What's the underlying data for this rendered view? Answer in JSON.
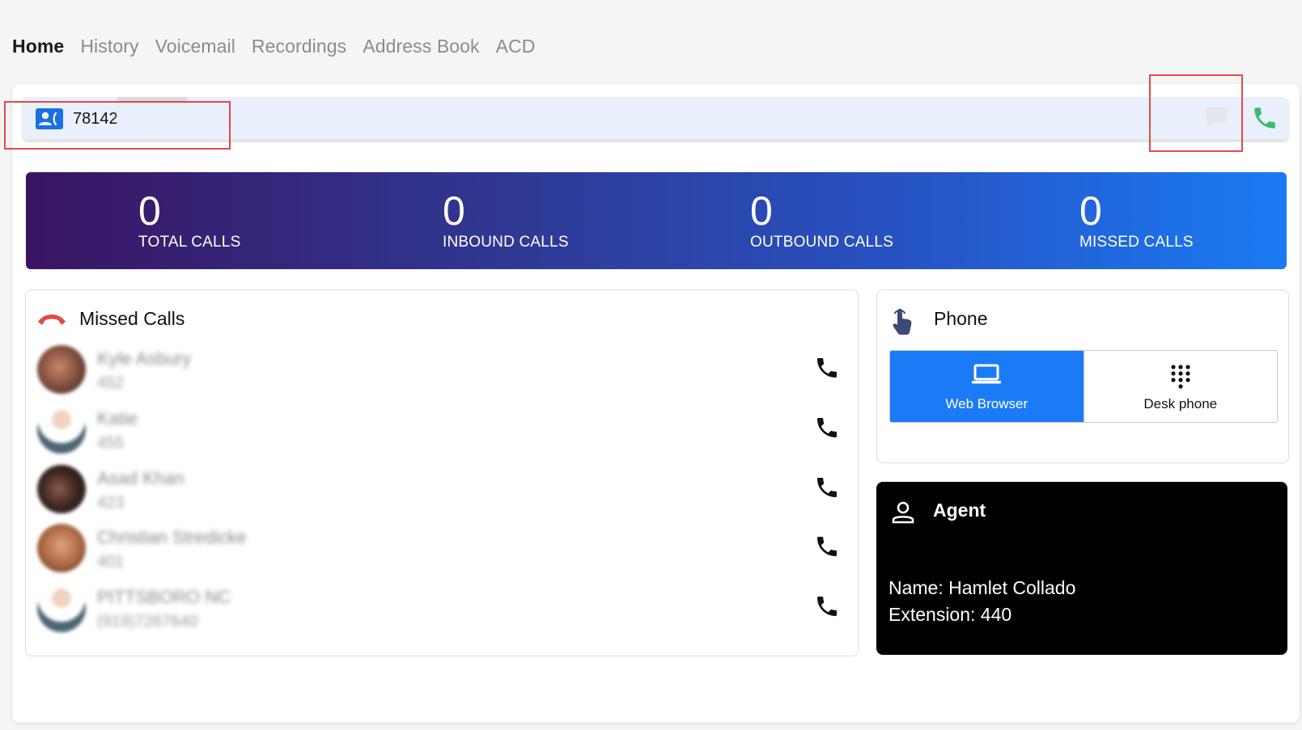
{
  "nav": {
    "tabs": [
      {
        "label": "Home",
        "active": true
      },
      {
        "label": "History",
        "active": false
      },
      {
        "label": "Voicemail",
        "active": false
      },
      {
        "label": "Recordings",
        "active": false
      },
      {
        "label": "Address Book",
        "active": false
      },
      {
        "label": "ACD",
        "active": false
      }
    ]
  },
  "dialer": {
    "number_value": "78142",
    "icons": [
      "contacts-icon",
      "sms-icon",
      "phone-call-icon"
    ]
  },
  "stats": [
    {
      "value": "0",
      "label": "TOTAL CALLS"
    },
    {
      "value": "0",
      "label": "INBOUND CALLS"
    },
    {
      "value": "0",
      "label": "OUTBOUND CALLS"
    },
    {
      "value": "0",
      "label": "MISSED CALLS"
    }
  ],
  "missed_calls": {
    "title": "Missed Calls",
    "items": [
      {
        "name": "Kyle Asbury",
        "ext": "452"
      },
      {
        "name": "Katie",
        "ext": "455"
      },
      {
        "name": "Asad Khan",
        "ext": "423"
      },
      {
        "name": "Christian Stredicke",
        "ext": "401"
      },
      {
        "name": "PITTSBORO NC",
        "ext": "(919)7267640"
      }
    ]
  },
  "phone": {
    "title": "Phone",
    "options": [
      {
        "label": "Web Browser",
        "active": true
      },
      {
        "label": "Desk phone",
        "active": false
      }
    ]
  },
  "agent": {
    "title": "Agent",
    "name_line": "Name: Hamlet Collado",
    "extension_line": "Extension: 440"
  },
  "colors": {
    "accent": "#1b7bf6",
    "call_green": "#3dbb6e",
    "hangup_red": "#e04b45",
    "banner_start": "#3a1462",
    "banner_end": "#1a7bf5"
  }
}
